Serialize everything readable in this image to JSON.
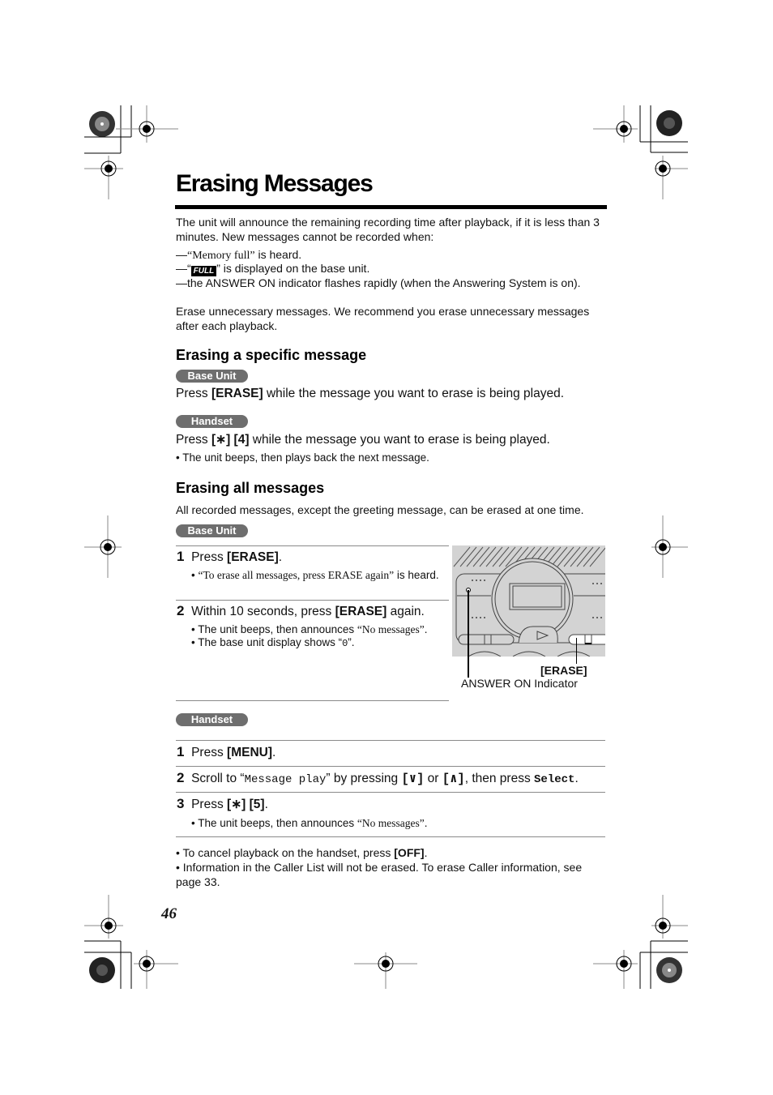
{
  "page": {
    "title": "Erasing Messages",
    "page_number": "46"
  },
  "intro": {
    "para1": "The unit will announce the remaining recording time after playback, if it is less than 3 minutes. New messages cannot be recorded when:",
    "cond1_dash": "—",
    "cond1_quote": "“Memory full”",
    "cond1_rest": " is heard.",
    "cond2_prefix": "—“",
    "cond2_badge": "FULL",
    "cond2_rest": "” is displayed on the base unit.",
    "cond3": "—the ANSWER ON indicator flashes rapidly (when the Answering System is on).",
    "para2": "Erase unnecessary messages. We recommend you erase unnecessary messages after each playback."
  },
  "specific": {
    "heading": "Erasing a specific message",
    "base_unit_label": "Base Unit",
    "base_pre": "Press ",
    "base_key": "[ERASE]",
    "base_post": " while the message you want to erase is being played.",
    "handset_label": "Handset",
    "hs_pre": "Press ",
    "hs_key": "[∗] [4]",
    "hs_post": " while the message you want to erase is being played.",
    "hs_note": "• The unit beeps, then plays back the next message."
  },
  "all": {
    "heading": "Erasing all messages",
    "desc": "All recorded messages, except the greeting message, can be erased at one time.",
    "base_unit_label": "Base Unit",
    "base_steps": [
      {
        "num": "1",
        "pre": "Press ",
        "key": "[ERASE]",
        "post": ".",
        "note_pre": "• ",
        "note_quote": "“To erase all messages, press ERASE again”",
        "note_post": " is heard."
      },
      {
        "num": "2",
        "pre": "Within 10 seconds, press ",
        "key": "[ERASE]",
        "post": " again.",
        "note1_pre": "• The unit beeps, then announces ",
        "note1_quote": "“No messages”",
        "note1_post": ".",
        "note2_pre": "• The base unit display shows “",
        "note2_val": "0",
        "note2_post": "”."
      }
    ],
    "figure": {
      "erase_label": "[ERASE]",
      "answer_on_label": "ANSWER ON Indicator"
    },
    "handset_label": "Handset",
    "handset_steps": [
      {
        "num": "1",
        "pre": "Press ",
        "key": "[MENU]",
        "post": "."
      },
      {
        "num": "2",
        "pre": "Scroll to “",
        "mono": "Message play",
        "mid": "” by pressing ",
        "key1": "[∨]",
        "or": " or ",
        "key2": "[∧]",
        "mid2": ", then press ",
        "soft": "Select",
        "post": "."
      },
      {
        "num": "3",
        "pre": "Press ",
        "key": "[∗] [5]",
        "post": ".",
        "note_pre": "• The unit beeps, then announces ",
        "note_quote": "“No messages”",
        "note_post": "."
      }
    ],
    "footnotes": [
      {
        "pre": "• To cancel playback on the handset, press ",
        "key": "[OFF]",
        "post": "."
      },
      {
        "text": "• Information in the Caller List will not be erased. To erase Caller information, see page 33."
      }
    ]
  }
}
